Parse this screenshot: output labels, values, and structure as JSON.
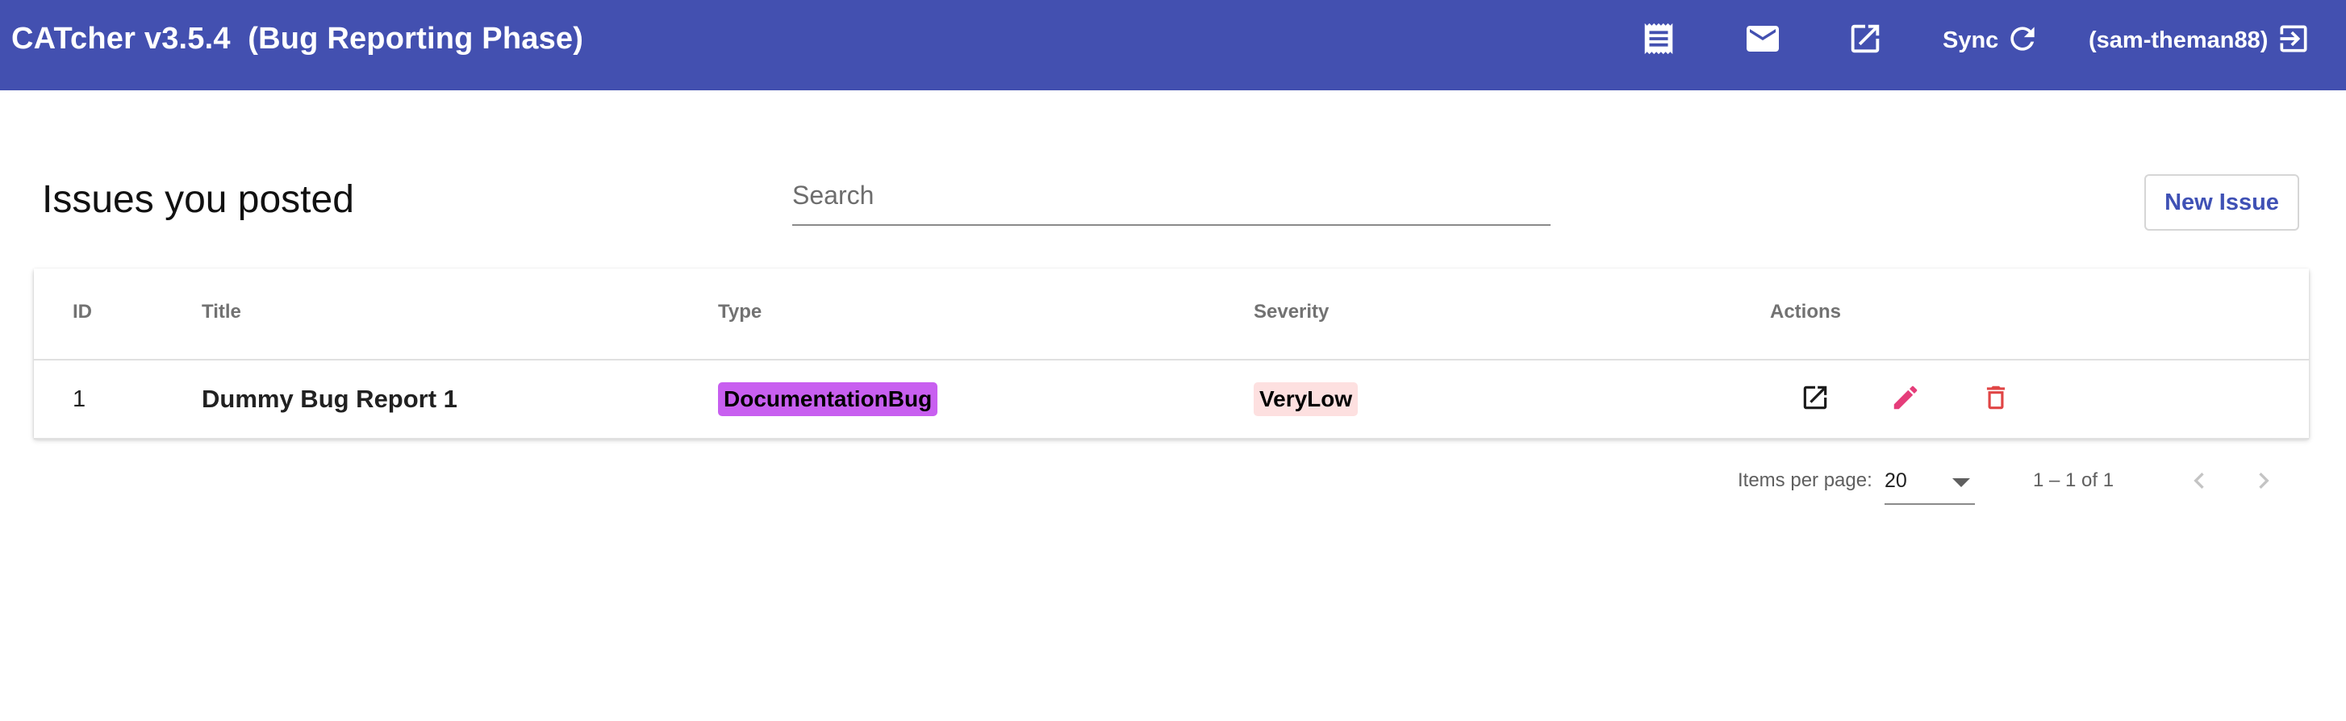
{
  "header": {
    "title": "CATcher v3.5.4  (Bug Reporting Phase)",
    "sync_label": "Sync",
    "user_label": "(sam-theman88)",
    "icons": [
      "receipt-icon",
      "mail-icon",
      "open-in-new-icon",
      "refresh-icon",
      "logout-icon"
    ],
    "bg_color": "#4350b0"
  },
  "page": {
    "title": "Issues you posted",
    "search_placeholder": "Search",
    "search_value": "",
    "new_issue_label": "New Issue"
  },
  "table": {
    "columns": [
      "ID",
      "Title",
      "Type",
      "Severity",
      "Actions"
    ],
    "rows": [
      {
        "id": "1",
        "title": "Dummy Bug Report 1",
        "type": "DocumentationBug",
        "type_color": "#c85ff0",
        "severity": "VeryLow",
        "severity_color": "#fde0e0",
        "actions": [
          "open-in-new-icon",
          "edit-icon",
          "delete-icon"
        ]
      }
    ]
  },
  "paginator": {
    "items_per_page_label": "Items per page:",
    "items_per_page_value": "20",
    "range_label": "1 – 1 of 1"
  }
}
